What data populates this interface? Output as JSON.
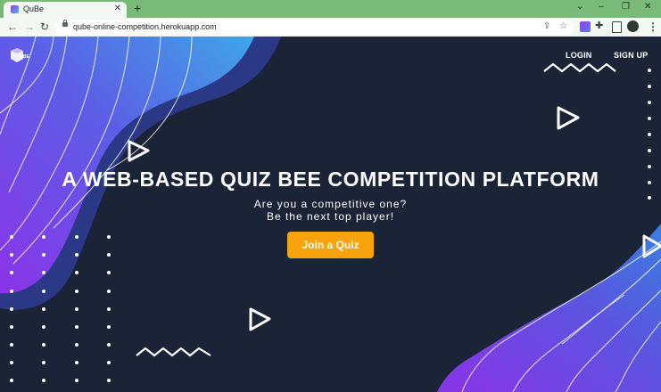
{
  "browser": {
    "tab_title": "QuBe",
    "url": "qube-online-competition.herokuapp.com"
  },
  "nav": {
    "login": "LOGIN",
    "signup": "SIGN UP"
  },
  "logo": {
    "text": "QBE"
  },
  "hero": {
    "title": "A WEB-BASED QUIZ BEE COMPETITION PLATFORM",
    "subtitle_line1": "Are you a competitive one?",
    "subtitle_line2": "Be the next top player!",
    "cta": "Join a Quiz"
  },
  "colors": {
    "background": "#1b2336",
    "accent": "#f7a30d",
    "wave_purple": "#8a33e8",
    "wave_blue": "#3fa6e6"
  }
}
